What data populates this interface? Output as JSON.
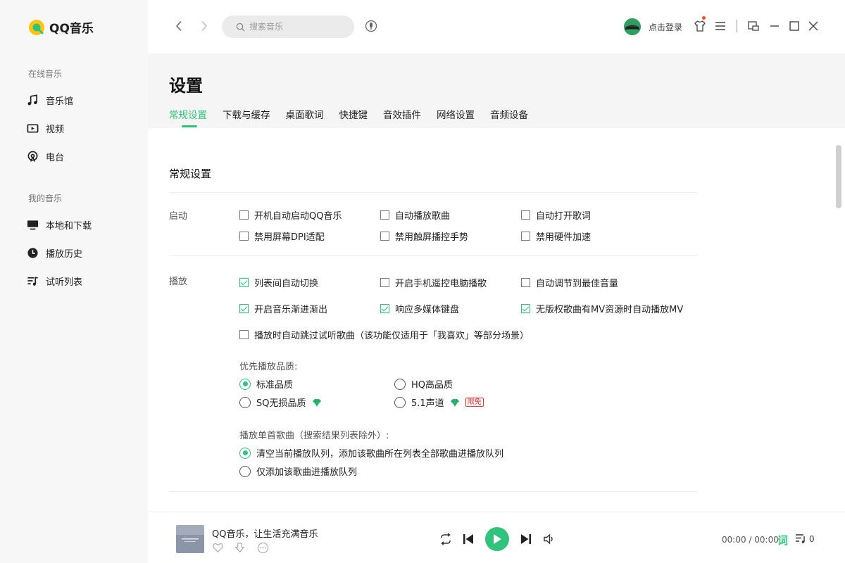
{
  "app": {
    "logo_text": "QQ音乐"
  },
  "sidebar": {
    "online_heading": "在线音乐",
    "online_items": [
      {
        "label": "音乐馆",
        "icon": "music-note-icon"
      },
      {
        "label": "视频",
        "icon": "video-icon"
      },
      {
        "label": "电台",
        "icon": "radio-icon"
      }
    ],
    "my_heading": "我的音乐",
    "my_items": [
      {
        "label": "本地和下载",
        "icon": "monitor-icon"
      },
      {
        "label": "播放历史",
        "icon": "clock-icon"
      },
      {
        "label": "试听列表",
        "icon": "playlist-icon"
      }
    ]
  },
  "topbar": {
    "search_placeholder": "搜索音乐",
    "login_label": "点击登录"
  },
  "page": {
    "title": "设置",
    "tabs": [
      "常规设置",
      "下载与缓存",
      "桌面歌词",
      "快捷键",
      "音效插件",
      "网络设置",
      "音频设备"
    ],
    "active_tab": "常规设置"
  },
  "settings": {
    "section_title": "常规设置",
    "startup": {
      "label": "启动",
      "options": [
        {
          "label": "开机自动启动QQ音乐",
          "checked": false
        },
        {
          "label": "自动播放歌曲",
          "checked": false
        },
        {
          "label": "自动打开歌词",
          "checked": false
        },
        {
          "label": "禁用屏幕DPI适配",
          "checked": false
        },
        {
          "label": "禁用触屏播控手势",
          "checked": false
        },
        {
          "label": "禁用硬件加速",
          "checked": false
        }
      ]
    },
    "playback": {
      "label": "播放",
      "options": [
        {
          "label": "列表间自动切换",
          "checked": true
        },
        {
          "label": "开启手机遥控电脑播歌",
          "checked": false
        },
        {
          "label": "自动调节到最佳音量",
          "checked": false
        },
        {
          "label": "开启音乐渐进渐出",
          "checked": true
        },
        {
          "label": "响应多媒体键盘",
          "checked": true
        },
        {
          "label": "无版权歌曲有MV资源时自动播放MV",
          "checked": true
        },
        {
          "label": "播放时自动跳过试听歌曲（该功能仅适用于「我喜欢」等部分场景）",
          "checked": false
        }
      ],
      "quality_heading": "优先播放品质:",
      "quality_options": [
        {
          "label": "标准品质",
          "selected": true
        },
        {
          "label": "HQ高品质",
          "selected": false
        },
        {
          "label": "SQ无损品质",
          "selected": false
        },
        {
          "label": "5.1声道",
          "selected": false
        }
      ],
      "limited_badge": "限免",
      "single_heading": "播放单首歌曲（搜索结果列表除外）:",
      "single_options": [
        {
          "label": "清空当前播放队列，添加该歌曲所在列表全部歌曲进播放队列",
          "selected": true
        },
        {
          "label": "仅添加该歌曲进播放队列",
          "selected": false
        }
      ]
    }
  },
  "player": {
    "song_title": "QQ音乐，让生活充满音乐",
    "time": "00:00 / 00:00",
    "lyric_label": "词",
    "playlist_count": "0"
  },
  "colors": {
    "accent": "#31c27c",
    "logo_yellow": "#ffc50b",
    "sidebar_bg": "#f7f7f7"
  }
}
